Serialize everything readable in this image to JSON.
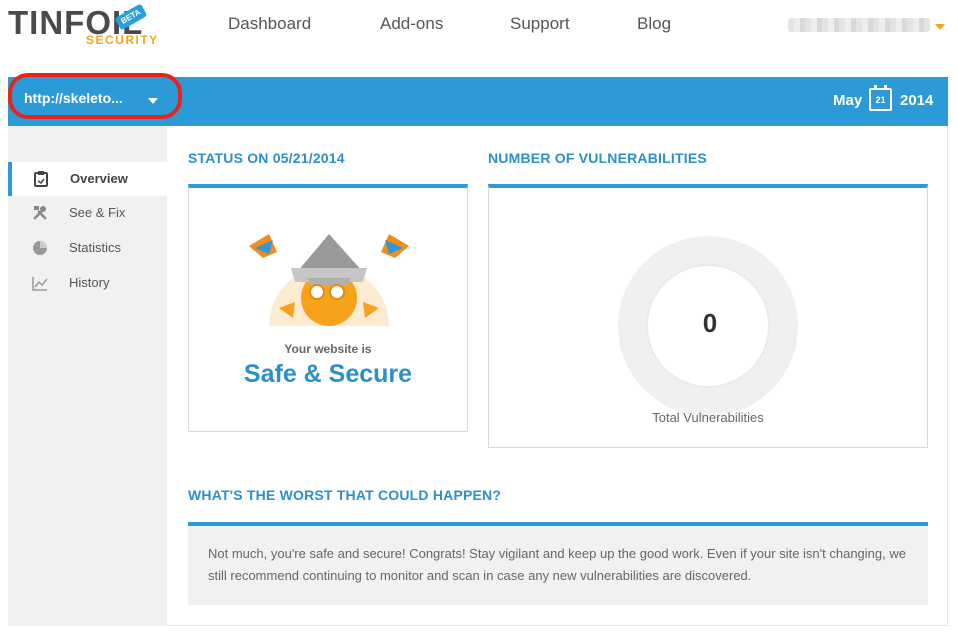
{
  "brand": {
    "name": "TINFOIL",
    "tagline": "SECURITY",
    "badge": "BETA",
    "colors": {
      "primary": "#2b9ad6",
      "accent": "#f4a51c",
      "highlight": "#e8231a"
    }
  },
  "nav": {
    "items": [
      "Dashboard",
      "Add-ons",
      "Support",
      "Blog"
    ],
    "user_menu_icon": "chevron-down-icon"
  },
  "toolbar": {
    "site_value": "http://skeleto...",
    "date": {
      "month": "May",
      "day": "21",
      "year": "2014"
    }
  },
  "sidebar": {
    "items": [
      {
        "label": "Overview",
        "icon": "clipboard-icon",
        "active": true
      },
      {
        "label": "See & Fix",
        "icon": "tools-icon",
        "active": false
      },
      {
        "label": "Statistics",
        "icon": "pie-chart-icon",
        "active": false
      },
      {
        "label": "History",
        "icon": "line-chart-icon",
        "active": false
      }
    ]
  },
  "status": {
    "title": "STATUS ON 05/21/2014",
    "pre": "Your website is",
    "main": "Safe & Secure"
  },
  "vulnerabilities": {
    "title": "NUMBER OF VULNERABILITIES",
    "count": "0",
    "label": "Total Vulnerabilities"
  },
  "worst": {
    "title": "WHAT'S THE WORST THAT COULD HAPPEN?",
    "text": "Not much, you're safe and secure! Congrats! Stay vigilant and keep up the good work. Even if your site isn't changing, we still recommend continuing to monitor and scan in case any new vulnerabilities are discovered."
  }
}
